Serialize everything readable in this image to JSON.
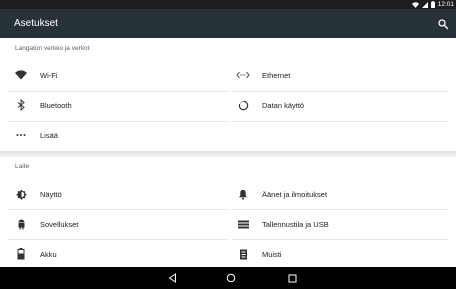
{
  "status_bar": {
    "time": "12:01",
    "icons": [
      "wifi-icon",
      "signal-icon",
      "battery-icon"
    ]
  },
  "app_bar": {
    "title": "Asetukset",
    "search_icon": "search-icon"
  },
  "sections": [
    {
      "header": "Langaton verkko ja verkot",
      "items": [
        {
          "label": "Wi-Fi",
          "icon": "wifi-icon"
        },
        {
          "label": "Ethernet",
          "icon": "ethernet-icon"
        },
        {
          "label": "Bluetooth",
          "icon": "bluetooth-icon"
        },
        {
          "label": "Datan käyttö",
          "icon": "data-usage-icon"
        },
        {
          "label": "Lisää",
          "icon": "more-icon"
        }
      ]
    },
    {
      "header": "Laite",
      "items": [
        {
          "label": "Näyttö",
          "icon": "brightness-icon"
        },
        {
          "label": "Äänet ja ilmoitukset",
          "icon": "bell-icon"
        },
        {
          "label": "Sovellukset",
          "icon": "android-icon"
        },
        {
          "label": "Tallennustila ja USB",
          "icon": "storage-icon"
        },
        {
          "label": "Akku",
          "icon": "battery-icon"
        },
        {
          "label": "Muisti",
          "icon": "memory-icon"
        }
      ]
    }
  ],
  "nav_bar": {
    "icons": [
      "back-icon",
      "home-icon",
      "recents-icon"
    ]
  },
  "colors": {
    "app_bar": "#263238",
    "status_bar": "#1f1f1f",
    "nav_bar": "#000000",
    "icon": "#333333"
  }
}
